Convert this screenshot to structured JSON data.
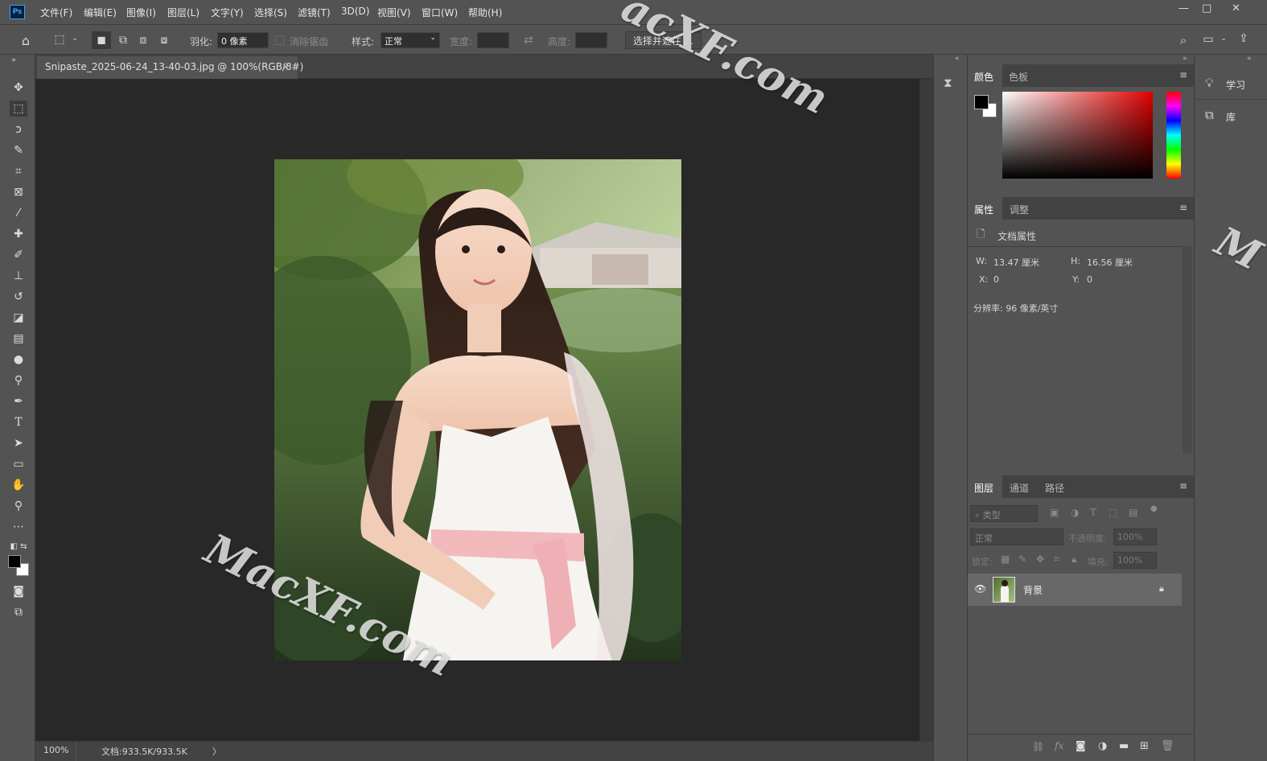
{
  "app": {
    "logo": "Ps"
  },
  "menu": [
    "文件(F)",
    "编辑(E)",
    "图像(I)",
    "图层(L)",
    "文字(Y)",
    "选择(S)",
    "滤镜(T)",
    "3D(D)",
    "视图(V)",
    "窗口(W)",
    "帮助(H)"
  ],
  "window_controls": {
    "minimize": "—",
    "maximize": "□",
    "close": "✕"
  },
  "options": {
    "feather_label": "羽化:",
    "feather_value": "0 像素",
    "antialias_label": "消除锯齿",
    "style_label": "样式:",
    "style_value": "正常",
    "width_label": "宽度:",
    "height_label": "高度:",
    "select_mask_button": "选择并遮住 ..."
  },
  "document": {
    "tab_title": "Snipaste_2025-06-24_13-40-03.jpg @ 100%(RGB/8#)",
    "tab_close": "×"
  },
  "status": {
    "zoom": "100%",
    "doc_info": "文档:933.5K/933.5K",
    "arrow": "〉"
  },
  "watermarks": {
    "main": "MacXF.com",
    "top": "acXF.com",
    "right": "M"
  },
  "color_panel": {
    "tabs": [
      "颜色",
      "色板"
    ],
    "foreground": "#000000",
    "background": "#ffffff",
    "hue": "#e00000"
  },
  "properties_panel": {
    "tabs": [
      "属性",
      "调整"
    ],
    "title": "文档属性",
    "w_label": "W:",
    "w_value": "13.47 厘米",
    "h_label": "H:",
    "h_value": "16.56 厘米",
    "x_label": "X:",
    "x_value": "0",
    "y_label": "Y:",
    "y_value": "0",
    "resolution": "分辨率: 96 像素/英寸"
  },
  "layers_panel": {
    "tabs": [
      "图层",
      "通道",
      "路径"
    ],
    "filter_placeholder": "类型",
    "blend_mode": "正常",
    "opacity_label": "不透明度:",
    "opacity_value": "100%",
    "lock_label": "锁定:",
    "fill_label": "填充:",
    "fill_value": "100%",
    "layers": [
      {
        "name": "背景",
        "visible": true,
        "locked": true
      }
    ]
  },
  "right_panels": {
    "learn": "学习",
    "libraries": "库"
  },
  "panel_menu": "≡"
}
